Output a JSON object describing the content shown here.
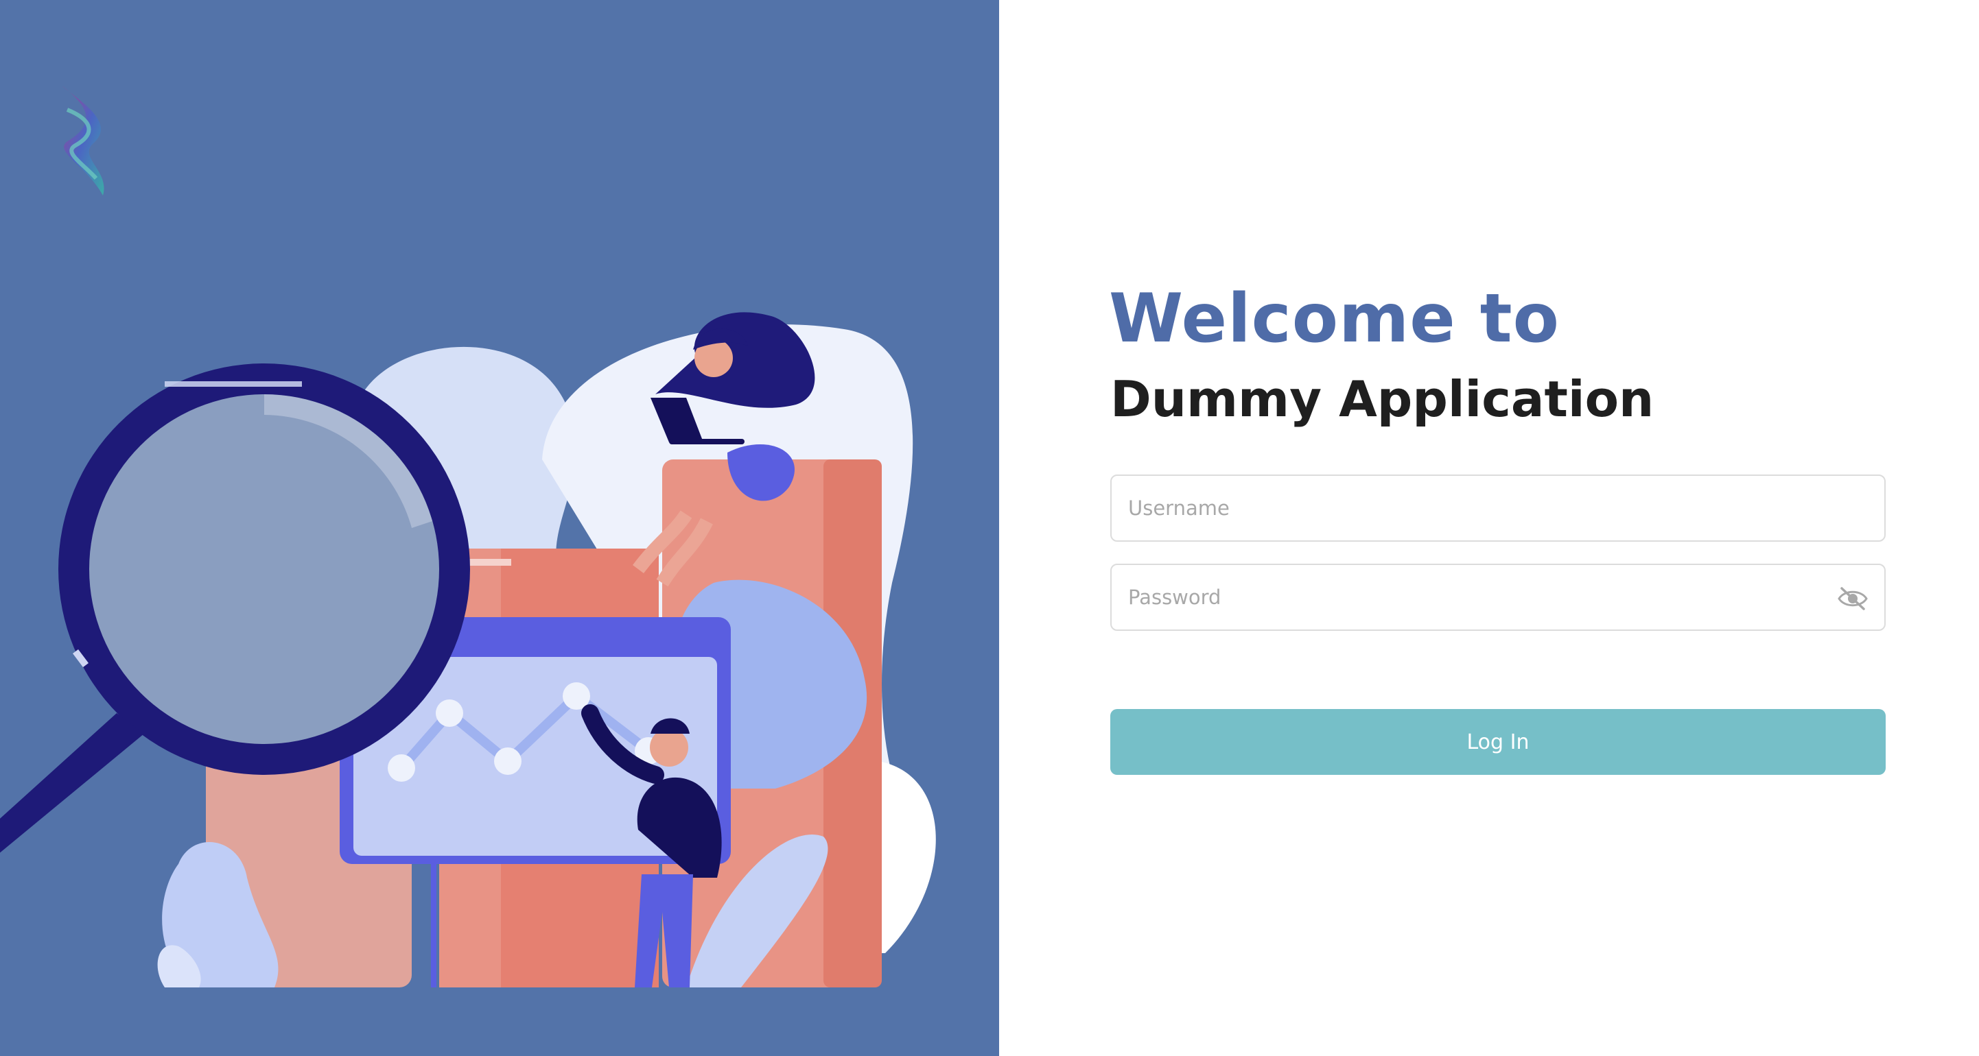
{
  "branding": {
    "logo_icon": "flame-ribbon-logo",
    "welcome_heading": "Welcome to",
    "app_name": "Dummy Application"
  },
  "login_form": {
    "username": {
      "placeholder": "Username",
      "value": ""
    },
    "password": {
      "placeholder": "Password",
      "value": "",
      "toggle_icon": "eye-slash-icon"
    },
    "submit_label": "Log In"
  },
  "colors": {
    "left_panel_bg": "#5373a9",
    "heading_accent": "#4f6ca8",
    "heading_dark": "#1f1f1f",
    "button_bg": "#76bfc8",
    "input_border": "#dcdcdc"
  }
}
